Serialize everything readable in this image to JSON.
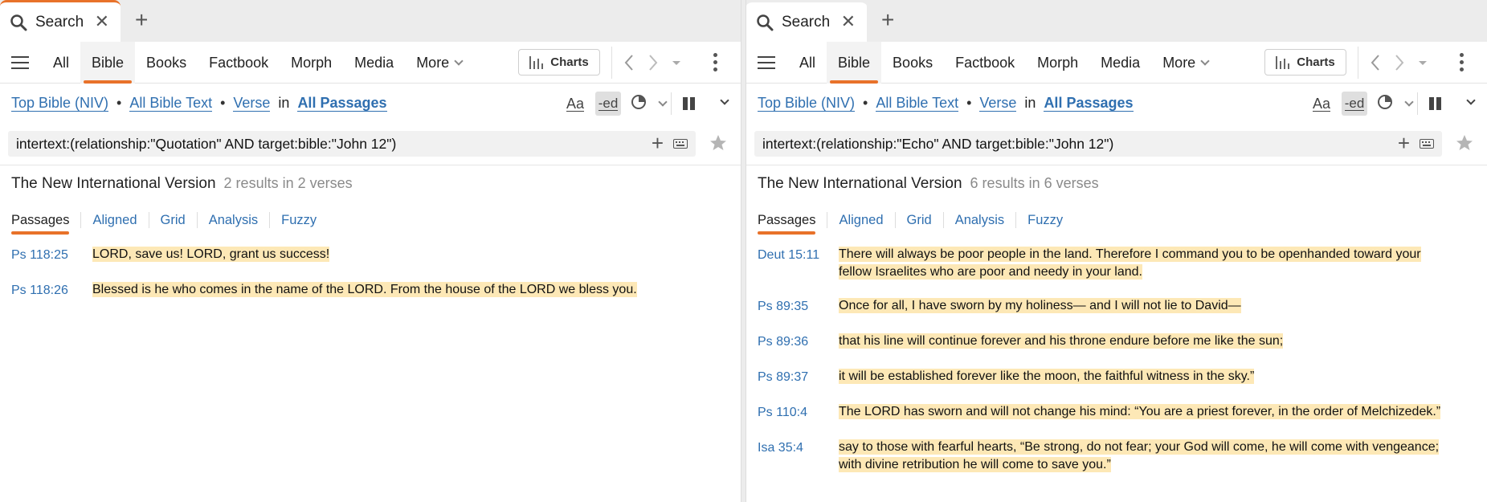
{
  "panels": [
    {
      "tab": {
        "label": "Search"
      },
      "nav_tabs": [
        "All",
        "Bible",
        "Books",
        "Factbook",
        "Morph",
        "Media",
        "More"
      ],
      "charts_label": "Charts",
      "scope": {
        "resource": "Top Bible (NIV)",
        "range": "All Bible Text",
        "unit": "Verse",
        "in": "in",
        "passages": "All Passages"
      },
      "tools": {
        "aa": "Aa",
        "ed": "-ed"
      },
      "query": "intertext:(relationship:\"Quotation\" AND target:bible:\"John 12\")",
      "result_title": "The New International Version",
      "result_count": "2 results in 2 verses",
      "subtabs": [
        "Passages",
        "Aligned",
        "Grid",
        "Analysis",
        "Fuzzy"
      ],
      "results": [
        {
          "ref": "Ps 118:25",
          "text": "LORD, save us! LORD, grant us success!"
        },
        {
          "ref": "Ps 118:26",
          "text": "Blessed is he who comes in the name of the LORD. From the house of the LORD we bless you."
        }
      ]
    },
    {
      "tab": {
        "label": "Search"
      },
      "nav_tabs": [
        "All",
        "Bible",
        "Books",
        "Factbook",
        "Morph",
        "Media",
        "More"
      ],
      "charts_label": "Charts",
      "scope": {
        "resource": "Top Bible (NIV)",
        "range": "All Bible Text",
        "unit": "Verse",
        "in": "in",
        "passages": "All Passages"
      },
      "tools": {
        "aa": "Aa",
        "ed": "-ed"
      },
      "query": "intertext:(relationship:\"Echo\" AND target:bible:\"John 12\")",
      "result_title": "The New International Version",
      "result_count": "6 results in 6 verses",
      "subtabs": [
        "Passages",
        "Aligned",
        "Grid",
        "Analysis",
        "Fuzzy"
      ],
      "results": [
        {
          "ref": "Deut 15:11",
          "text": "There will always be poor people in the land. Therefore I command you to be openhanded toward your fellow Israelites who are poor and needy in your land."
        },
        {
          "ref": "Ps 89:35",
          "text": "Once for all, I have sworn by my holiness— and I will not lie to David—"
        },
        {
          "ref": "Ps 89:36",
          "text": "that his line will continue forever and his throne endure before me like the sun;"
        },
        {
          "ref": "Ps 89:37",
          "text": "it will be established forever like the moon, the faithful witness in the sky.”"
        },
        {
          "ref": "Ps 110:4",
          "text": "The LORD has sworn and will not change his mind: “You are a priest forever, in the order of Melchizedek.”"
        },
        {
          "ref": "Isa 35:4",
          "text": "say to those with fearful hearts, “Be strong, do not fear; your God will come, he will come with vengeance; with divine retribution he will come to save you.”"
        }
      ]
    }
  ],
  "colors": {
    "accent": "#e8722a",
    "link": "#2f6fb0",
    "highlight": "#fde8b6"
  }
}
